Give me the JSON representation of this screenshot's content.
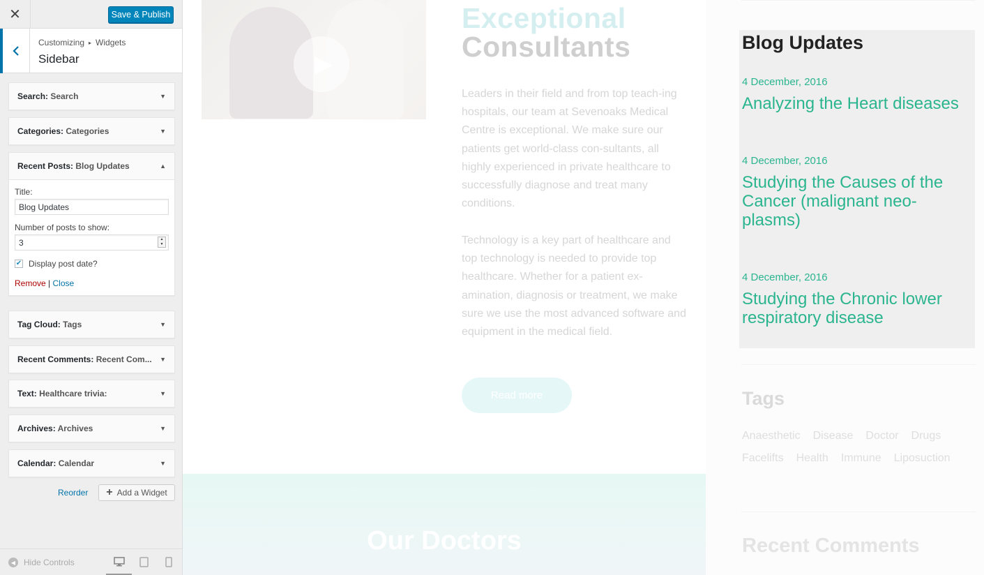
{
  "customizer": {
    "close_glyph": "✕",
    "save_label": "Save & Publish",
    "breadcrumb": [
      "Customizing",
      "Widgets"
    ],
    "section_title": "Sidebar",
    "widgets": [
      {
        "type": "Search",
        "name": "Search"
      },
      {
        "type": "Categories",
        "name": "Categories"
      },
      {
        "type": "Recent Posts",
        "name": "Blog Updates",
        "expanded": true
      },
      {
        "type": "Tag Cloud",
        "name": "Tags"
      },
      {
        "type": "Recent Comments",
        "name": "Recent Com..."
      },
      {
        "type": "Text",
        "name": "Healthcare trivia:"
      },
      {
        "type": "Archives",
        "name": "Archives"
      },
      {
        "type": "Calendar",
        "name": "Calendar"
      }
    ],
    "recent_posts_form": {
      "title_label": "Title:",
      "title_value": "Blog Updates",
      "count_label": "Number of posts to show:",
      "count_value": "3",
      "display_date_label": "Display post date?",
      "display_date_checked": true,
      "remove_label": "Remove",
      "separator": "|",
      "close_label": "Close"
    },
    "reorder_label": "Reorder",
    "add_widget_label": "Add a Widget",
    "hide_controls_label": "Hide Controls",
    "device_icons": [
      "desktop-icon",
      "tablet-icon",
      "mobile-icon"
    ]
  },
  "preview": {
    "heading_line1": "Exceptional",
    "heading_line2": "Consultants",
    "paragraph1": "Leaders in their field and from top teach-ing hospitals, our team at Sevenoaks Medical Centre is exceptional. We make sure our patients get world-class con-sultants, all highly experienced in private healthcare to successfully diagnose and treat many conditions.",
    "paragraph2": "Technology is a key part of healthcare and top technology is needed to provide top healthcare. Whether for a patient ex-amination, diagnosis or treatment, we make sure we use the most advanced software and equipment in the medical field.",
    "read_more": "Read more",
    "doctors_heading": "Our Doctors",
    "blog_title": "Blog Updates",
    "posts": [
      {
        "date": "4 December, 2016",
        "title": "Analyzing the Heart diseases"
      },
      {
        "date": "4 December, 2016",
        "title": "Studying the Causes of the Cancer (malignant neo-plasms)"
      },
      {
        "date": "4 December, 2016",
        "title": "Studying the Chronic lower respiratory disease"
      }
    ],
    "tags_heading": "Tags",
    "tags": [
      "Anaesthetic",
      "Disease",
      "Doctor",
      "Drugs",
      "Facelifts",
      "Health",
      "Immune",
      "Liposuction"
    ],
    "recent_comments_heading": "Recent Comments",
    "colors": {
      "accent_green": "#2bb58f",
      "wp_blue": "#0085ba"
    }
  }
}
